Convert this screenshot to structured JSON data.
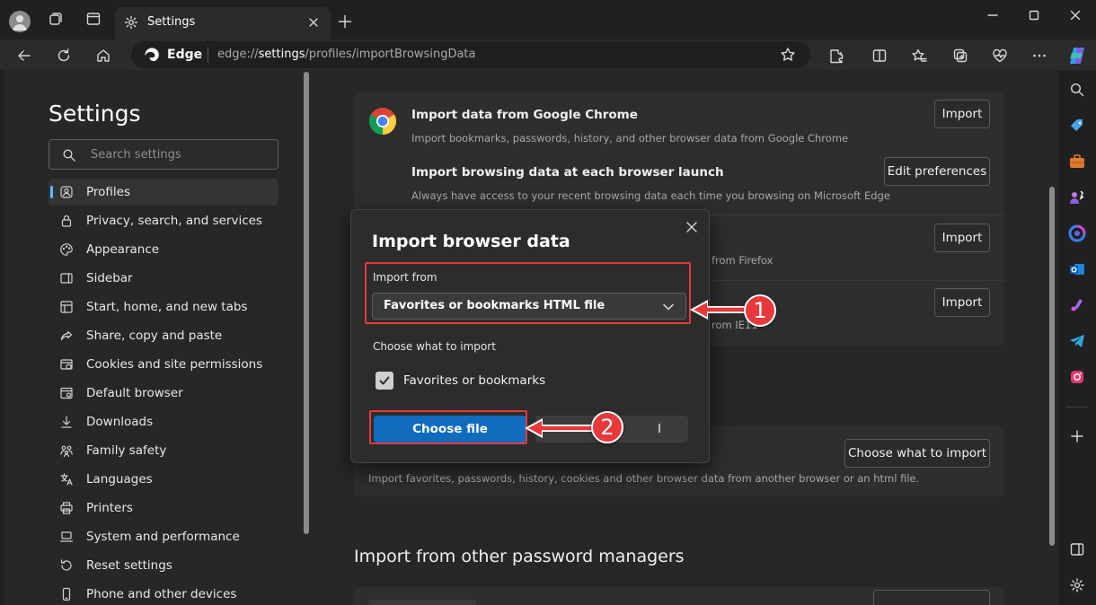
{
  "tab": {
    "title": "Settings"
  },
  "address": {
    "site_label": "Edge",
    "url_prefix": "edge://",
    "url_bold": "settings",
    "url_rest": "/profiles/importBrowsingData"
  },
  "sidebar": {
    "title": "Settings",
    "search_placeholder": "Search settings",
    "items": [
      {
        "label": "Profiles",
        "icon": "profile-icon"
      },
      {
        "label": "Privacy, search, and services",
        "icon": "lock-icon"
      },
      {
        "label": "Appearance",
        "icon": "palette-icon"
      },
      {
        "label": "Sidebar",
        "icon": "sidebar-icon"
      },
      {
        "label": "Start, home, and new tabs",
        "icon": "home-grid-icon"
      },
      {
        "label": "Share, copy and paste",
        "icon": "share-icon"
      },
      {
        "label": "Cookies and site permissions",
        "icon": "cookie-icon"
      },
      {
        "label": "Default browser",
        "icon": "browser-icon"
      },
      {
        "label": "Downloads",
        "icon": "download-icon"
      },
      {
        "label": "Family safety",
        "icon": "family-icon"
      },
      {
        "label": "Languages",
        "icon": "language-icon"
      },
      {
        "label": "Printers",
        "icon": "printer-icon"
      },
      {
        "label": "System and performance",
        "icon": "laptop-icon"
      },
      {
        "label": "Reset settings",
        "icon": "reset-icon"
      },
      {
        "label": "Phone and other devices",
        "icon": "phone-icon"
      }
    ]
  },
  "main": {
    "chrome_title": "Import data from Google Chrome",
    "chrome_desc": "Import bookmarks, passwords, history, and other browser data from Google Chrome",
    "launch_title": "Import browsing data at each browser launch",
    "launch_desc": "Always have access to your recent browsing data each time you browsing on Microsoft Edge",
    "firefox_desc_partial": "from Firefox",
    "ie_desc_partial": "rom IE11",
    "import_label": "Import",
    "edit_prefs_label": "Edit preferences",
    "choose_what_label": "Choose what to import",
    "other_desc": "Import favorites, passwords, history, cookies and other browser data from another browser or an html file.",
    "password_section_title": "Import from other password managers"
  },
  "dialog": {
    "title": "Import browser data",
    "import_from_label": "Import from",
    "import_from_value": "Favorites or bookmarks HTML file",
    "choose_label": "Choose what to import",
    "checkbox_label": "Favorites or bookmarks",
    "checkbox_checked": true,
    "primary_button": "Choose file",
    "secondary_button_visible": "l"
  },
  "annotations": [
    {
      "number": "1"
    },
    {
      "number": "2"
    }
  ],
  "colors": {
    "accent": "#0f6cbd",
    "highlight": "#e8383b",
    "active_indicator": "#4cc2ff"
  }
}
